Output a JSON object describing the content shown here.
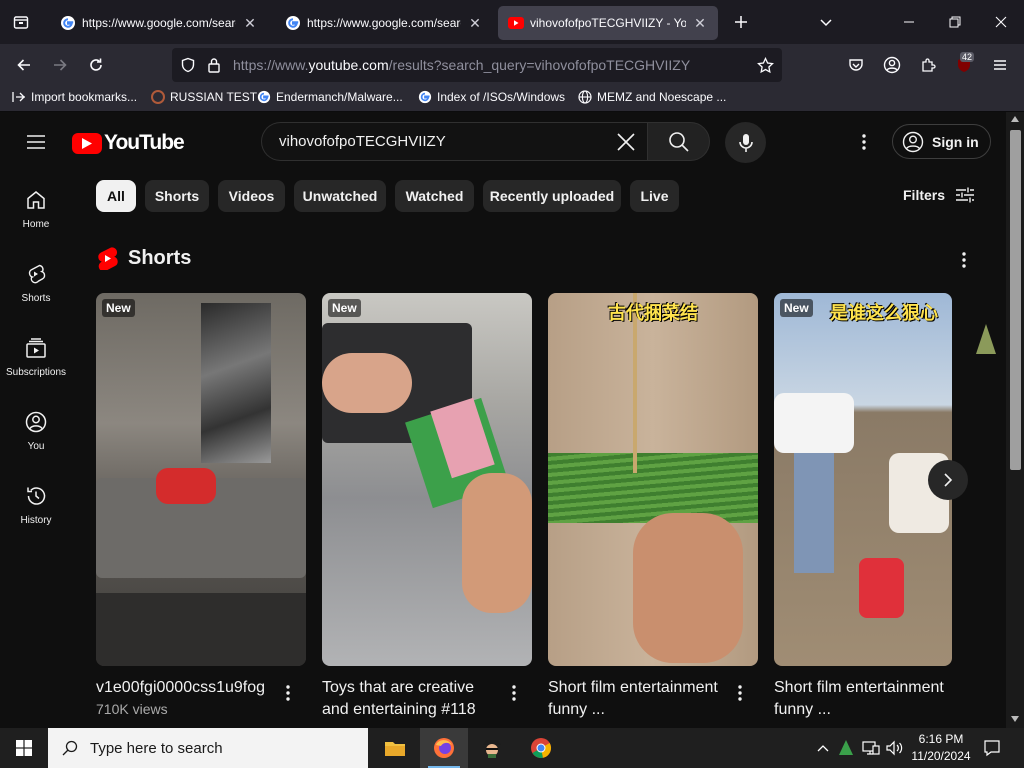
{
  "browser": {
    "tabs": [
      {
        "title": "https://www.google.com/search",
        "active": false
      },
      {
        "title": "https://www.google.com/search",
        "active": false
      },
      {
        "title": "vihovofofpoTECGHVIIZY - YouTube",
        "active": true
      }
    ],
    "url_prefix": "https://www.",
    "url_domain": "youtube.com",
    "url_rest": "/results?search_query=vihovofofpoTECGHVIIZY",
    "extensions_badge": "42",
    "bookmarks": [
      {
        "label": "Import bookmarks...",
        "icon": "import-icon"
      },
      {
        "label": "RUSSIAN TEST",
        "icon": "globe-icon"
      },
      {
        "label": "Endermanch/Malware...",
        "icon": "google-icon"
      },
      {
        "label": "Index of /ISOs/Windows",
        "icon": "google-icon"
      },
      {
        "label": "MEMZ and Noescape ...",
        "icon": "globe-icon"
      }
    ]
  },
  "youtube": {
    "logo_text": "YouTube",
    "search_query": "vihovofofpoTECGHVIIZY",
    "sign_in": "Sign in",
    "sidebar": [
      {
        "label": "Home",
        "icon": "home-icon"
      },
      {
        "label": "Shorts",
        "icon": "shorts-icon"
      },
      {
        "label": "Subscriptions",
        "icon": "subscriptions-icon"
      },
      {
        "label": "You",
        "icon": "you-icon"
      },
      {
        "label": "History",
        "icon": "history-icon"
      }
    ],
    "chips": [
      "All",
      "Shorts",
      "Videos",
      "Unwatched",
      "Watched",
      "Recently uploaded",
      "Live"
    ],
    "filters_label": "Filters",
    "shorts_heading": "Shorts",
    "shorts": [
      {
        "title": "v1e00fgi0000css1u9fog",
        "views": "710K views",
        "badge": "New",
        "caption": ""
      },
      {
        "title": "Toys that are creative and entertaining #118",
        "views": "",
        "badge": "New",
        "caption": ""
      },
      {
        "title": "Short film entertainment funny ...",
        "views": "",
        "badge": "",
        "caption": "古代捆菜结"
      },
      {
        "title": "Short film entertainment funny ...",
        "views": "",
        "badge": "New",
        "caption": "是谁这么狠心"
      }
    ]
  },
  "taskbar": {
    "search_placeholder": "Type here to search",
    "time": "6:16 PM",
    "date": "11/20/2024"
  },
  "colors": {
    "yt_red": "#ff0000",
    "bg": "#0f0f0f",
    "chip": "#272727",
    "firefox_tab": "#42414d"
  }
}
